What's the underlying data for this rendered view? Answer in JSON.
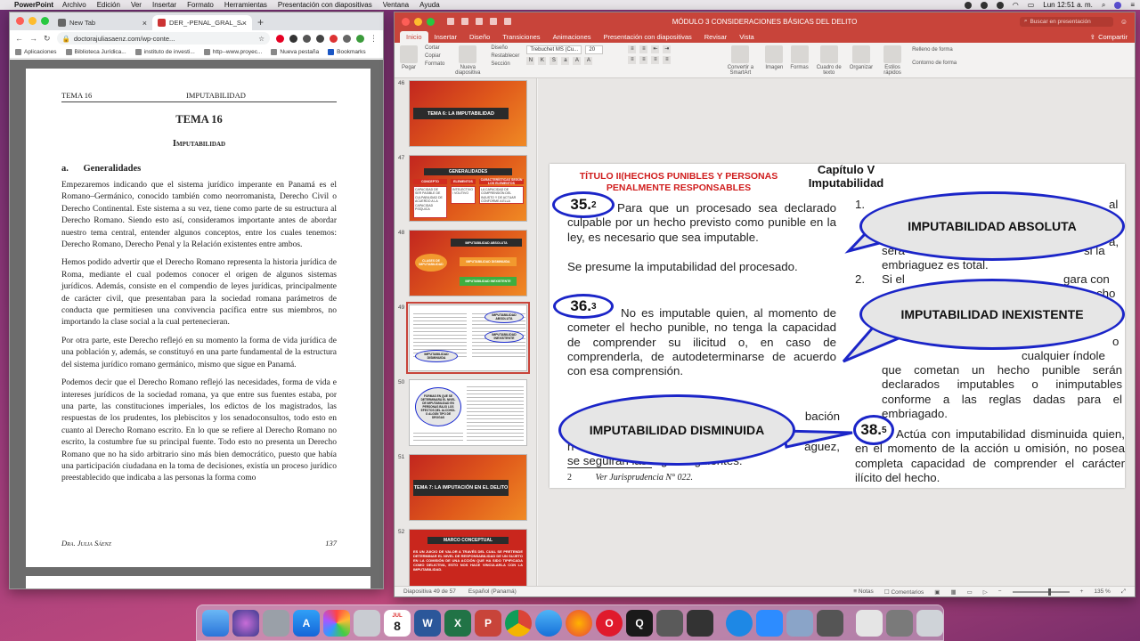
{
  "menubar": {
    "app": "PowerPoint",
    "items": [
      "Archivo",
      "Edición",
      "Ver",
      "Insertar",
      "Formato",
      "Herramientas",
      "Presentación con diapositivas",
      "Ventana",
      "Ayuda"
    ],
    "clock": "Lun 12:51 a. m."
  },
  "chrome": {
    "tabs": [
      {
        "label": "New Tab"
      },
      {
        "label": "DER_-PENAL_GRAL_SAENZ-1."
      }
    ],
    "url": "doctorajuliasaenz.com/wp-conte...",
    "bookmarks": [
      "Aplicaciones",
      "Biblioteca Jurídica...",
      "instituto de investi...",
      "http--www.proyec...",
      "Nueva pestaña",
      "Bookmarks"
    ]
  },
  "pdf": {
    "header_left": "TEMA 16",
    "header_center": "IMPUTABILIDAD",
    "title": "TEMA 16",
    "subtitle": "Imputabilidad",
    "section_num": "a.",
    "section_title": "Generalidades",
    "paragraphs": [
      "Empezaremos indicando que el sistema jurídico imperante en Panamá es el Romano–Germánico, conocido también como neorromanista, Derecho Civil o Derecho Continental. Este sistema a su vez, tiene como parte de su estructura al Derecho Romano. Siendo esto así, consideramos importante antes de abordar nuestro tema central, entender algunos conceptos, entre los cuales tenemos: Derecho Romano, Derecho Penal y la Relación existentes entre ambos.",
      "Hemos podido advertir que el Derecho Romano representa la historia jurídica de Roma, mediante el cual podemos conocer el origen de algunos sistemas jurídicos. Además, consiste en el compendio de leyes jurídicas, principalmente de carácter civil, que presentaban para la sociedad romana parámetros de conducta que permitiesen una convivencia pacífica entre sus miembros, no importando la clase social a la cual pertenecieran.",
      "Por otra parte, este Derecho reflejó en su momento la forma de vida jurídica de una población y, además, se constituyó en una parte fundamental de la estructura del sistema jurídico romano germánico, mismo que sigue en Panamá.",
      "Podemos decir que el Derecho Romano reflejó las necesidades, forma de vida e intereses jurídicos de la sociedad romana, ya que entre sus fuentes estaba, por una parte, las constituciones imperiales, los edictos de los magistrados, las respuestas de los prudentes, los plebiscitos y los senadoconsultos, todo esto en cuanto al Derecho Romano escrito. En lo que se refiere al Derecho Romano no escrito, la costumbre fue su principal fuente. Todo esto no presenta un Derecho Romano que no ha sido arbitrario sino más bien democrático, puesto que había una participación ciudadana en la toma de decisiones, existía un proceso jurídico preestablecido que indicaba a las personas la forma como"
    ],
    "footer_left": "Dra. Julia Sáenz",
    "footer_page": "137"
  },
  "ppt": {
    "doc_title": "MÓDULO 3 CONSIDERACIONES BÁSICAS DEL DELITO",
    "search_placeholder": "Buscar en presentación",
    "tabs": [
      "Inicio",
      "Insertar",
      "Diseño",
      "Transiciones",
      "Animaciones",
      "Presentación con diapositivas",
      "Revisar",
      "Vista"
    ],
    "share": "Compartir",
    "ribbon": {
      "paste": "Pegar",
      "cut": "Cortar",
      "copy": "Copiar",
      "format": "Formato",
      "new_slide": "Nueva diapositiva",
      "layout": "Diseño",
      "reset": "Restablecer",
      "section": "Sección",
      "font_name": "Trebuchet MS (Cu...",
      "font_size": "20",
      "convert_smartart": "Convertir a SmartArt",
      "image": "Imagen",
      "shapes": "Formas",
      "textbox": "Cuadro de texto",
      "arrange": "Organizar",
      "quick_styles": "Estilos rápidos",
      "fill": "Relleno de forma",
      "outline": "Contorno de forma"
    },
    "thumbnails": {
      "n46": "46",
      "t46": "TEMA 6: LA IMPUTABILIDAD",
      "n47": "47",
      "t47": "GENERALIDADES",
      "t47_cols": [
        "CONCEPTO",
        "ELEMENTOS",
        "CARACTERÍSTICAS SEGÚN LOS ELEMENTOS"
      ],
      "t47_c1": "CAPACIDAD DE SER PASIBLE DE CULPABILIDAD DE ACUERDO A LA CAPACIDAD PSÍQUICA",
      "t47_c2": "INTELECTIVO / VOLITIVO",
      "t47_c3": "LA CAPACIDAD DE COMPRENSIÓN DEL INJUSTO Y DE ACTUAR CONFORME A ELLA",
      "n48": "48",
      "t48_left": "CLASES DE IMPUTABILIDAD",
      "t48_items": [
        "IMPUTABILIDAD ABSOLUTA",
        "IMPUTABILIDAD DISMINUIDA",
        "IMPUTABILIDAD INEXISTENTE"
      ],
      "n49": "49",
      "n50": "50",
      "t50_oval": "FORMAS EN QUE SE DETERMINARÁ EL NIVEL DE IMPUTABILIDAD EN PERSONAS BAJO LOS EFECTOS DEL ALCOHOL O ALGÚN TIPO DE DROGAS",
      "n51": "51",
      "t51": "TEMA 7: LA IMPUTACIÓN EN EL DELITO",
      "n52": "52",
      "t52_title": "MARCO CONCEPTUAL",
      "t52_body": "ES UN JUICIO DE VALOR A TRAVÉS DEL CUAL SE PRETENDE DETERMINAR EL NIVEL DE RESPONSABILIDAD DE UN SUJETO EN LA COMISIÓN DE UNA ACCIÓN QUE HA SIDO TIPIFICADA COMO DELICTIVA, ESTO NOS HACE VINCULARLA CON LA IMPUTABILIDAD."
    },
    "slide": {
      "title": "TÍTULO II(HECHOS PUNIBLES Y PERSONAS PENALMENTE RESPONSABLES",
      "chapter": "Capítulo V Imputabilidad",
      "art35_num": "35.",
      "art35_sup": "2",
      "art35_text": "Para que un procesado sea declarado culpable por un hecho previsto como punible en la ley, es necesario que sea imputable.",
      "art35_text2": "Se presume la imputabilidad del procesado.",
      "art36_num": "36.",
      "art36_sup": "3",
      "art36_text": "No es imputable quien, al momento de cometer el hecho punible, no tenga la capacidad de comprender su ilicitud o, en caso de comprenderla, de autodeterminarse de acuerdo con esa comprensión.",
      "art37_visible_a": "bación",
      "art37_visible_b": "h",
      "art37_visible_c": "aguez,",
      "art37_visible_d": "se seguirán las reglas siguientes:",
      "right_frag1": "1.",
      "right_frag1b": "al",
      "right_frag2": "a,",
      "right_frag3": "será",
      "right_frag3b": "si la",
      "right_frag4": "embriaguez es total.",
      "right_frag5": "2.",
      "right_frag6": "Si el",
      "right_frag6b": "gara con",
      "right_frag7": "cho",
      "right_frag8": "o",
      "right_frag9": "cualquier índole",
      "right_frag10": "que cometan un hecho punible serán declarados imputables o inimputables conforme a las reglas dadas para el embriagado.",
      "art38_num": "38.",
      "art38_sup": "5",
      "art38_text": "Actúa con imputabilidad disminuida quien, en el momento de la acción u omisión, no posea completa capacidad de comprender el carácter ilícito del hecho.",
      "bubble_absoluta": "IMPUTABILIDAD ABSOLUTA",
      "bubble_inexistente": "IMPUTABILIDAD INEXISTENTE",
      "bubble_disminuida": "IMPUTABILIDAD DISMINUIDA",
      "footnote_num": "2",
      "footnote_text": "Ver Jurisprudencia N° 022."
    },
    "status": {
      "slide_info": "Diapositiva 49 de 57",
      "language": "Español (Panamá)",
      "notes": "Notas",
      "comments": "Comentarios",
      "zoom": "135 %"
    }
  },
  "dock": {
    "calendar_month": "JUL",
    "calendar_day": "8"
  }
}
